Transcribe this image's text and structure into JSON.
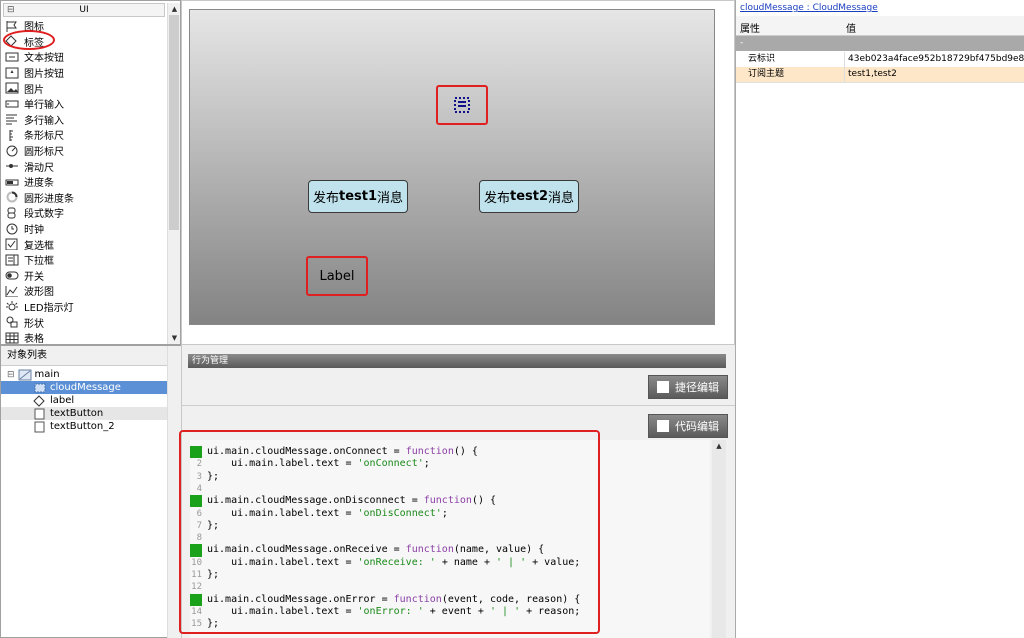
{
  "ui_panel": {
    "title": "UI",
    "collapse_glyph": "⊟",
    "items": [
      {
        "label": "图标",
        "icon": "flag-icon"
      },
      {
        "label": "标签",
        "icon": "tag-icon"
      },
      {
        "label": "文本按钮",
        "icon": "text-button-icon"
      },
      {
        "label": "图片按钮",
        "icon": "image-button-icon"
      },
      {
        "label": "图片",
        "icon": "image-icon"
      },
      {
        "label": "单行输入",
        "icon": "single-line-input-icon"
      },
      {
        "label": "多行输入",
        "icon": "multi-line-input-icon"
      },
      {
        "label": "条形标尺",
        "icon": "bar-gauge-icon"
      },
      {
        "label": "圆形标尺",
        "icon": "round-gauge-icon"
      },
      {
        "label": "滑动尺",
        "icon": "slider-icon"
      },
      {
        "label": "进度条",
        "icon": "progress-bar-icon"
      },
      {
        "label": "圆形进度条",
        "icon": "round-progress-icon"
      },
      {
        "label": "段式数字",
        "icon": "segment-digit-icon"
      },
      {
        "label": "时钟",
        "icon": "clock-icon"
      },
      {
        "label": "复选框",
        "icon": "checkbox-icon"
      },
      {
        "label": "下拉框",
        "icon": "dropdown-icon"
      },
      {
        "label": "开关",
        "icon": "switch-icon"
      },
      {
        "label": "波形图",
        "icon": "waveform-icon"
      },
      {
        "label": "LED指示灯",
        "icon": "led-icon"
      },
      {
        "label": "形状",
        "icon": "shape-icon"
      },
      {
        "label": "表格",
        "icon": "table-icon"
      }
    ]
  },
  "object_panel": {
    "title": "对象列表",
    "tree": [
      {
        "label": "main",
        "level": 0,
        "selected": false,
        "icon": "page-icon"
      },
      {
        "label": "cloudMessage",
        "level": 1,
        "selected": true,
        "icon": "cloud-message-icon"
      },
      {
        "label": "label",
        "level": 1,
        "selected": false,
        "icon": "tag-icon"
      },
      {
        "label": "textButton",
        "level": 1,
        "selected": false,
        "icon": "button-icon"
      },
      {
        "label": "textButton_2",
        "level": 1,
        "selected": false,
        "icon": "button-icon"
      }
    ]
  },
  "canvas": {
    "buttons": [
      {
        "prefix": "发布",
        "bold": "test1",
        "suffix": "消息"
      },
      {
        "prefix": "发布",
        "bold": "test2",
        "suffix": "消息"
      }
    ],
    "label_text": "Label"
  },
  "behavior": {
    "title": "行为管理",
    "shortcut_edit": "捷径编辑",
    "code_edit": "代码编辑",
    "code_lines": [
      {
        "n": "1",
        "mark": true,
        "text": "ui.main.cloudMessage.onConnect = function() {"
      },
      {
        "n": "2",
        "mark": false,
        "text": "    ui.main.label.text = 'onConnect';"
      },
      {
        "n": "3",
        "mark": false,
        "text": "};"
      },
      {
        "n": "4",
        "mark": false,
        "text": ""
      },
      {
        "n": "5",
        "mark": true,
        "text": "ui.main.cloudMessage.onDisconnect = function() {"
      },
      {
        "n": "6",
        "mark": false,
        "text": "    ui.main.label.text = 'onDisConnect';"
      },
      {
        "n": "7",
        "mark": false,
        "text": "};"
      },
      {
        "n": "8",
        "mark": false,
        "text": ""
      },
      {
        "n": "9",
        "mark": true,
        "text": "ui.main.cloudMessage.onReceive = function(name, value) {"
      },
      {
        "n": "10",
        "mark": false,
        "text": "    ui.main.label.text = 'onReceive: ' + name + ' | ' + value;"
      },
      {
        "n": "11",
        "mark": false,
        "text": "};"
      },
      {
        "n": "12",
        "mark": false,
        "text": ""
      },
      {
        "n": "13",
        "mark": true,
        "text": "ui.main.cloudMessage.onError = function(event, code, reason) {"
      },
      {
        "n": "14",
        "mark": false,
        "text": "    ui.main.label.text = 'onError: ' + event + ' | ' + reason;"
      },
      {
        "n": "15",
        "mark": false,
        "text": "};"
      }
    ]
  },
  "properties": {
    "title": "cloudMessage : CloudMessage",
    "col_property": "属性",
    "col_value": "值",
    "group": "-",
    "rows": [
      {
        "key": "云标识",
        "value": "43eb023a4face952b18729bf475bd9e8"
      },
      {
        "key": "订阅主题",
        "value": "test1,test2"
      }
    ]
  },
  "colors": {
    "selection": "#5b8fd6",
    "highlight_red": "#e02020",
    "line_marker": "#1aa31a",
    "button_fill": "#bfe2ec"
  }
}
